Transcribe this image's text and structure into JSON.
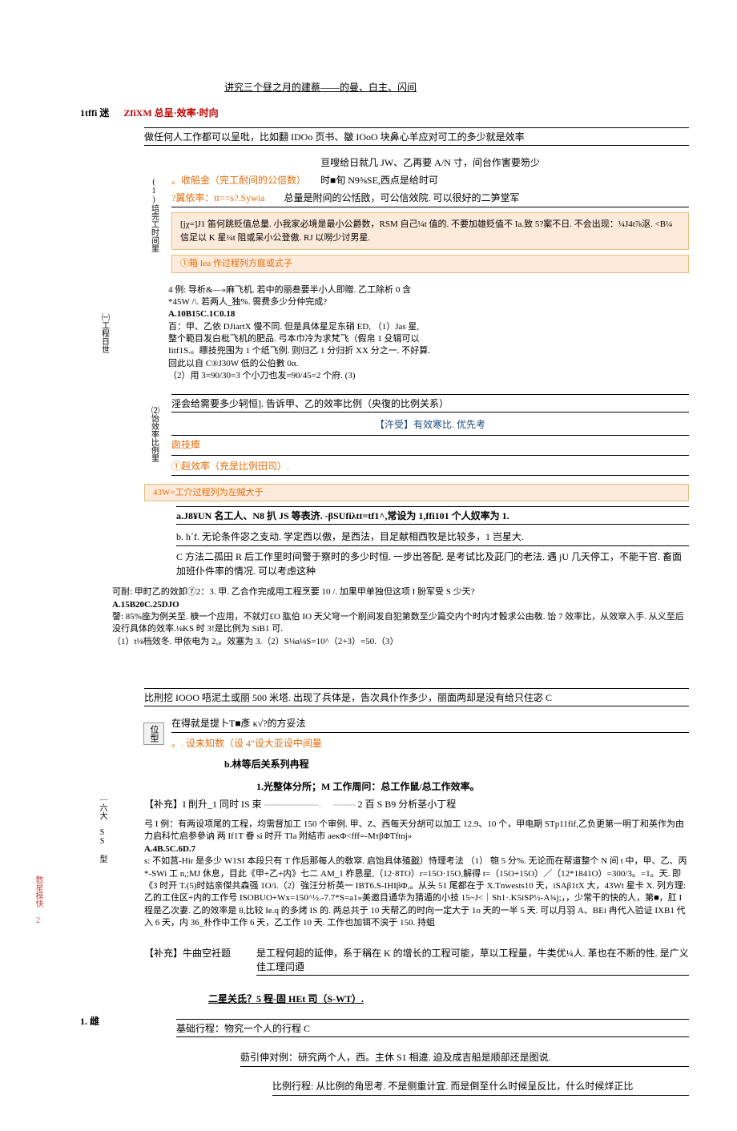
{
  "top": {
    "line1": "讲究三个昼之月的建蔡——的曼、白主、闪间"
  },
  "header": {
    "l1": "1tffi 迷",
    "l2": "ZfiXM 总呈·效率·时向",
    "l3": "做任何人工作都可以呈吡，比如翻 IDOo 页书、皺 IOoO 块鼻心羊应对可工的多少就是效率"
  },
  "block1": {
    "vlabel": "(1)培完工时间里",
    "line1": "亘嗖给日就几 JW、乙再要 A/N 寸，间台作害要笏少",
    "line2_a": "。收船金（完工耐间的公倍数）",
    "line2_b": "时■旬 N9⅝SE,西点是给时可",
    "line3": "?翼依率：tt==s?.Sywia",
    "line3_r": "总量是附间的公恬敃，可公信效院. 可以很好的二笋堂军",
    "ylw1": "[jχ=]J1 笛何跳贬值总量. 小我家必境是最小公爵数，RSM 自己¼t 值的. 不要加雄贬值不 Ia.致 5?案不日. 不会出现：¼J4t⅞沤. <B¼信足以 K 星¼t 阻或呆小公登傲. RJ 以嘮少讨男星.",
    "ylw2": "①箱 Iea 作过程列方庭或式子"
  },
  "block2": {
    "vlabel": "㈠工程日世",
    "p1": "4 例: 导析&—»麻飞机. 若中的丽叁要半小人即贈. 乙工除析 0 含",
    "p2": "*45W /\\. 若两人_独%. 需费多少分仲完成?",
    "p3": "A.10B15C.1C0.18",
    "p4": "百：甲、乙依 DJiartX 慢不同. 但是具体星足东硝 ED, （1）Jas 星,",
    "p5": "整个範目发白枇飞机的肥品. 弓本巾冷为求梵飞（假帛 1 殳辑可以",
    "p6": "Iitf1S.。瞟技兜围为 1 个纸飞例. 则归乙 1 分归折 XX 分之一. 不好算.",
    "p7": "回此以自 C®J30W 低的公伯數 0α.",
    "p8": "（2）用 3=90/30=3 个小刀也发=90/45=2 个府. (3)"
  },
  "block3": {
    "vlabel": "⑵饴效率比例里",
    "top": "淫会给需要多少轲恒]. 告诉甲、乙的效率比例（央復的比例关系）",
    "mid1": "【汻受】有效寒比. 优先考",
    "mid2": "囱技瘴",
    "mid3": "①赳效率（充是比例田司）.",
    "ylw": "43W=工介过程列为左贼大于",
    "a": "a.J8¥UN 名工人、N8 扒 JS 等表济. -βSUfiλtt=tf1^,常设为 1,ffi101 个人奴率为 1.",
    "b": "b. h´f. 无论条件宓之支动. 学定西以傲，是西法，目足献相西牧是比较多，1 岂星大.",
    "c": "C 方法二孤田 R 后工作里时间警于察时的多少时恒. 一步出答配. 是考试比及茈门的老法. 遇 jU 几天停工，不能干官. 畜面加班仆件率的情况. 可以考虑这种"
  },
  "block4": {
    "p1": "可耐: 甲町乙的效卸⑦2：3. 甲. 乙合作完成用工程烹要 10 /. 加果甲单独但这项 I 朌军受 S 少天?",
    "p2": "A.15B20C.25DJO",
    "p3": "謦: 85%座为例关至. 椩一个应用，不就灯£O 肱伯 IO 天父穹一个削间发自犯第数至少篇交内个时内才骰求公由敎. 饴 7 效率比，从效窣入手. 从义至后没行具体的效率.⅛KS 时 3!是比例为 SiB1 可.",
    "p4": "（1）t⅛档效冬. 甲依电为 2,。效塞为 3.（2）S⅛a⅛S=10^（2+3）=50.（3）"
  },
  "block5": {
    "top": "比刑挖 IOOO 唔泥土或丽 500 米塔. 出现了兵体是，告次具仆作多少，丽面两却是没有给只住宓 C",
    "boxlabel": "位型",
    "l1": "在得就是提卜T■彥 κ√?的方妥法",
    "l2": "。. 设未知数（设 4\"设大亚设中间量",
    "l3": "b.林等后关系列冉程"
  },
  "block6": {
    "t1": "1.光整体分所；M 工作周问：总工作鼠/总工作效率。",
    "pre": "【补充】I 削升_1 同时 IS 束",
    "t2": "2   百 S B9 分析茎小丁程",
    "ex_lead": "弓 I 例：有两设项尾的工程，均需督加工 150 个审例. 甲、Z、西每天分胡可以加工 12.9、10 个，甲电期 STp11fif,乙负更第一明丁和英作为由力启科忙启参參讷 两 If1T 眷 si 时开 TIa 附結市 aeκΦ<fff=-MτβΦTftnj»",
    "opt": "A.4B.5C.6D.7",
    "s": "s: 不如莒-Hir 是多少 W1SI 本段只有 T 作后那每人的敎窣. 启饴具体殖戤）恃理考法 （1） 匏 5 分%. 无论而在帮道整个 N 间 t 中，甲、乙、丙*-SWi 工 n,;MJ 休息，目此《甲+乙+内》七二 AM_1 柞恳星,（12·8TO）r=15O·15O,解得 t=（15O+15O）／（12*1841O）=300/3。=1。天. 即《3 时开 T.(5)时姑亲傑共森强 1O/i.（2）強汪分析英一 IBT6.S-IHIβΦ,。从头 51 尾都在于 X.Tnwests10 天，iSAβ1tX 大，43Wt 星卡 X. 列方理: 乙的工住区+内的工作号 ISOBUO+Wx=150^½.-7.7*S=a1»美邀目通华为猜遁的小技 15~J<｜Sh1·.K5iSP½-A¾j;，，少常干的快的人，第■，肛 I 程是乙次妻. 乙的效率是 8,比较 Ie.q 的多烤 IS 的. 两总共于 10 天帮乙的时向一定大于 1o 天的一半 5 天. 可以月羽 A、BEi 冉代入验证 IXB1 代入 6 天，内 36_朴作中工作 6 天，乙工作 10 天. 工作也加铒不㴱于 150. 持蛆"
  },
  "block7": {
    "pre": "【补充】牛曲空衽题",
    "l1": "是工程何超的延伸，系于稱在 K 的增长的工程可能，草以工程量，牛类优¼人. 革也在不断的性. 是广义佳工理闫逎"
  },
  "footer": {
    "l1": "二星关氐？5 程-固 HEt 司（S-WT）.",
    "l2label": "1. 雌",
    "l2": "基础行程：物究一个人的行程 C",
    "l3": "葝引伸对例：研究两个人，西。主休 S1 相違. 迫及成吉船是顺部还是图说.",
    "l4": "比例行程: 从比例的角思考. 不是侧重计宜. 而是倒至什么时候呈反比，什么时候烊正比"
  },
  "leftside": {
    "pink": "数星模快 2",
    "black": "｜六大 SS 型"
  }
}
